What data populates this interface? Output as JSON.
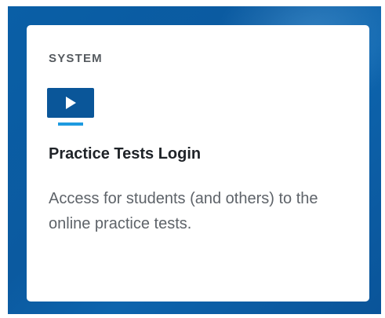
{
  "card": {
    "category": "SYSTEM",
    "icon": "play-video-icon",
    "title": "Practice Tests Login",
    "description": "Access for students (and others) to the online practice tests."
  },
  "colors": {
    "background_blue": "#0b5aa0",
    "icon_blue": "#0a5699",
    "icon_underline": "#1e9be0",
    "title_text": "#1f2328",
    "body_text": "#5e6369",
    "category_text": "#555a5f"
  }
}
